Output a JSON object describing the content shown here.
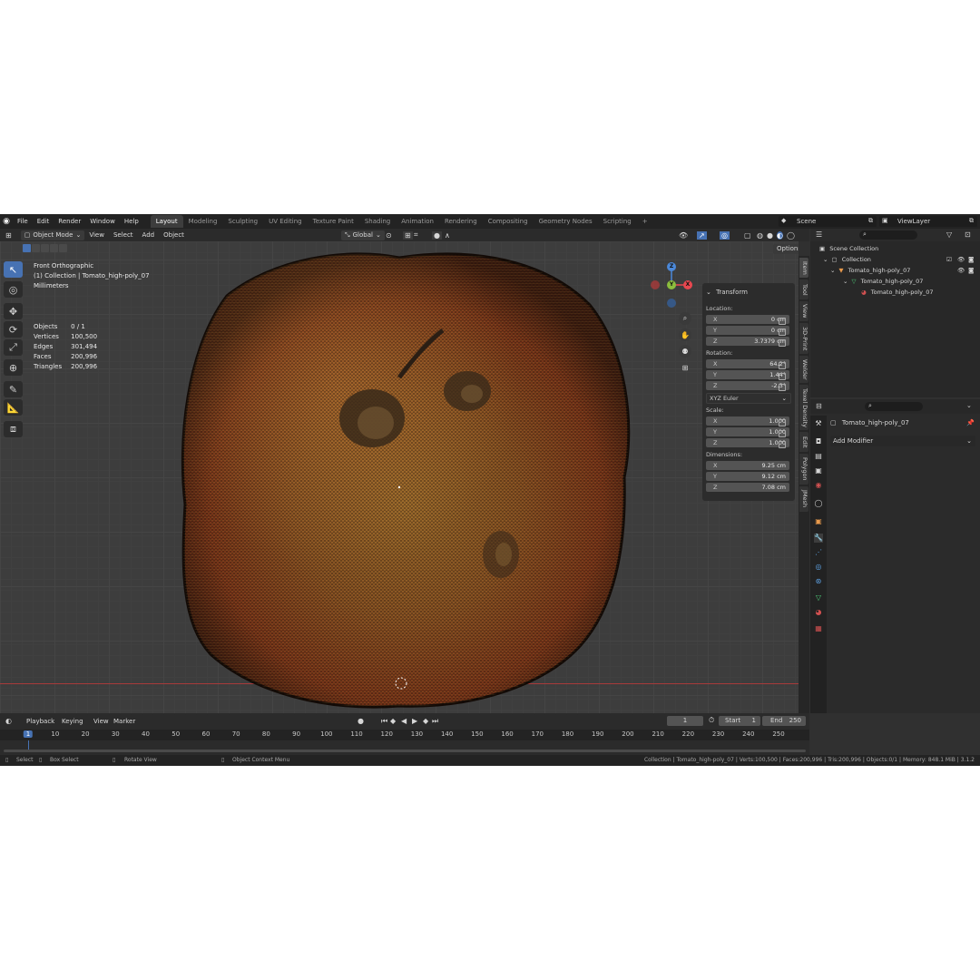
{
  "topbar": {
    "menus": [
      "File",
      "Edit",
      "Render",
      "Window",
      "Help"
    ],
    "workspaces": [
      "Layout",
      "Modeling",
      "Sculpting",
      "UV Editing",
      "Texture Paint",
      "Shading",
      "Animation",
      "Rendering",
      "Compositing",
      "Geometry Nodes",
      "Scripting"
    ],
    "active_workspace": "Layout",
    "add_tab": "+",
    "scene": "Scene",
    "view_layer": "ViewLayer"
  },
  "viewport_header": {
    "mode": "Object Mode",
    "menus": [
      "View",
      "Select",
      "Add",
      "Object"
    ],
    "orientation": "Global",
    "options": "Options"
  },
  "viewport": {
    "view_name": "Front Orthographic",
    "collection_line": "(1) Collection | Tomato_high-poly_07",
    "units": "Millimeters",
    "stats": [
      {
        "label": "Objects",
        "value": "0 / 1"
      },
      {
        "label": "Vertices",
        "value": "100,500"
      },
      {
        "label": "Edges",
        "value": "301,494"
      },
      {
        "label": "Faces",
        "value": "200,996"
      },
      {
        "label": "Triangles",
        "value": "200,996"
      }
    ],
    "gizmo": {
      "x": "X",
      "y": "Y",
      "z": "Z"
    },
    "colors": {
      "x_axis": "#e8474f",
      "y_axis": "#8bbd3d",
      "z_axis": "#4b88d9",
      "active_tool": "#4772b3"
    }
  },
  "transform": {
    "header": "Transform",
    "location_label": "Location:",
    "location": [
      {
        "axis": "X",
        "value": "0 cm"
      },
      {
        "axis": "Y",
        "value": "0 cm"
      },
      {
        "axis": "Z",
        "value": "3.7379 cm"
      }
    ],
    "rotation_label": "Rotation:",
    "rotation": [
      {
        "axis": "X",
        "value": "64.2°"
      },
      {
        "axis": "Y",
        "value": "1.44°"
      },
      {
        "axis": "Z",
        "value": "-2.3°"
      }
    ],
    "rotation_mode": "XYZ Euler",
    "scale_label": "Scale:",
    "scale": [
      {
        "axis": "X",
        "value": "1.000"
      },
      {
        "axis": "Y",
        "value": "1.000"
      },
      {
        "axis": "Z",
        "value": "1.000"
      }
    ],
    "dimensions_label": "Dimensions:",
    "dimensions": [
      {
        "axis": "X",
        "value": "9.25 cm"
      },
      {
        "axis": "Y",
        "value": "9.12 cm"
      },
      {
        "axis": "Z",
        "value": "7.08 cm"
      }
    ]
  },
  "sidebar_tabs": [
    "Item",
    "Tool",
    "View",
    "3D-Print",
    "Welder",
    "Texel Density",
    "Edit",
    "Polygon",
    "JMesh"
  ],
  "outliner": {
    "rows": [
      "Scene Collection",
      "Collection",
      "Tomato_high-poly_07",
      "Tomato_high-poly_07",
      "Tomato_high-poly_07"
    ]
  },
  "properties": {
    "object_name": "Tomato_high-poly_07",
    "add_modifier": "Add Modifier"
  },
  "timeline": {
    "menus": [
      "Playback",
      "Keying",
      "View",
      "Marker"
    ],
    "current_frame": "1",
    "start_label": "Start",
    "start": "1",
    "end_label": "End",
    "end": "250",
    "ticks": [
      "1",
      "10",
      "20",
      "30",
      "40",
      "50",
      "60",
      "70",
      "80",
      "90",
      "100",
      "110",
      "120",
      "130",
      "140",
      "150",
      "160",
      "170",
      "180",
      "190",
      "200",
      "210",
      "220",
      "230",
      "240",
      "250"
    ]
  },
  "statusbar": {
    "select": "Select",
    "box_select": "Box Select",
    "rotate_view": "Rotate View",
    "context_menu": "Object Context Menu",
    "info": "Collection | Tomato_high-poly_07 | Verts:100,500 | Faces:200,996 | Tris:200,996 | Objects:0/1 | Memory: 848.1 MiB | 3.1.2"
  }
}
